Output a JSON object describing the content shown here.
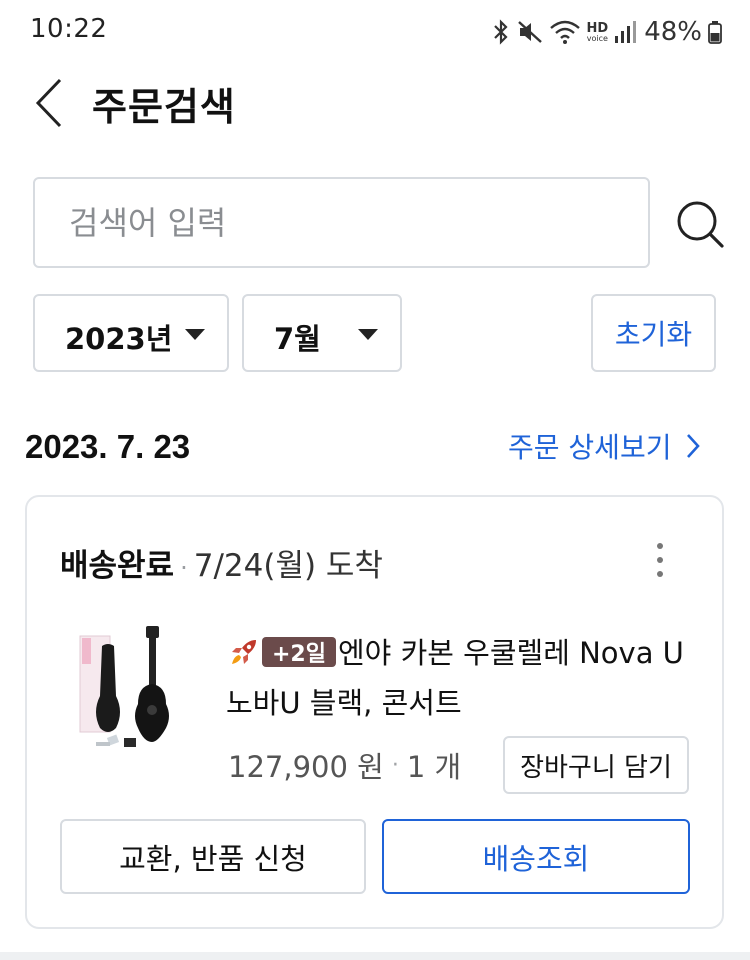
{
  "status_bar": {
    "time": "10:22",
    "battery": "48%",
    "hd_label": "HD",
    "voice_label": "voice",
    "icons": [
      "bluetooth-icon",
      "mute-icon",
      "wifi-icon",
      "hd-voice-icon",
      "signal-icon",
      "battery-icon"
    ]
  },
  "header": {
    "title": "주문검색",
    "back_icon": "chevron-left-icon"
  },
  "search": {
    "placeholder": "검색어 입력",
    "value": "",
    "icon": "search-icon"
  },
  "filters": {
    "year": "2023년",
    "month": "7월",
    "reset_label": "초기화"
  },
  "order_group": {
    "date": "2023. 7. 23",
    "detail_link": "주문 상세보기",
    "link_color": "#1f63d8"
  },
  "order": {
    "status": "배송완료",
    "arrival": "7/24(월) 도착",
    "badge": "+2일",
    "product_name": "엔야 카본 우쿨렐레 Nova U 노바U 블랙, 콘서트",
    "price": "127,900 원",
    "quantity": "1 개",
    "cart_button": "장바구니 담기",
    "return_button": "교환, 반품 신청",
    "track_button": "배송조회",
    "badge_color": "#6b4b4b"
  }
}
